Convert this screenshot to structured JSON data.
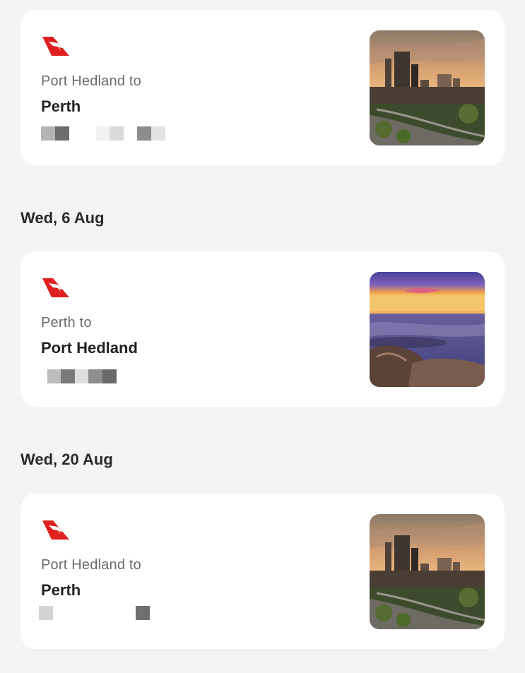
{
  "trips": [
    {
      "from_label": "Port Hedland to",
      "to_label": "Perth",
      "airline_icon": "qantas-logo-icon",
      "photo": "perth-skyline-sunset"
    },
    {
      "date": "Wed, 6 Aug",
      "from_label": "Perth to",
      "to_label": "Port Hedland",
      "airline_icon": "qantas-logo-icon",
      "photo": "port-hedland-sunset-coast"
    },
    {
      "date": "Wed, 20 Aug",
      "from_label": "Port Hedland to",
      "to_label": "Perth",
      "airline_icon": "qantas-logo-icon",
      "photo": "perth-skyline-sunset"
    }
  ],
  "colors": {
    "background": "#f4f4f4",
    "card": "#ffffff",
    "qantas_red": "#e0201f"
  }
}
